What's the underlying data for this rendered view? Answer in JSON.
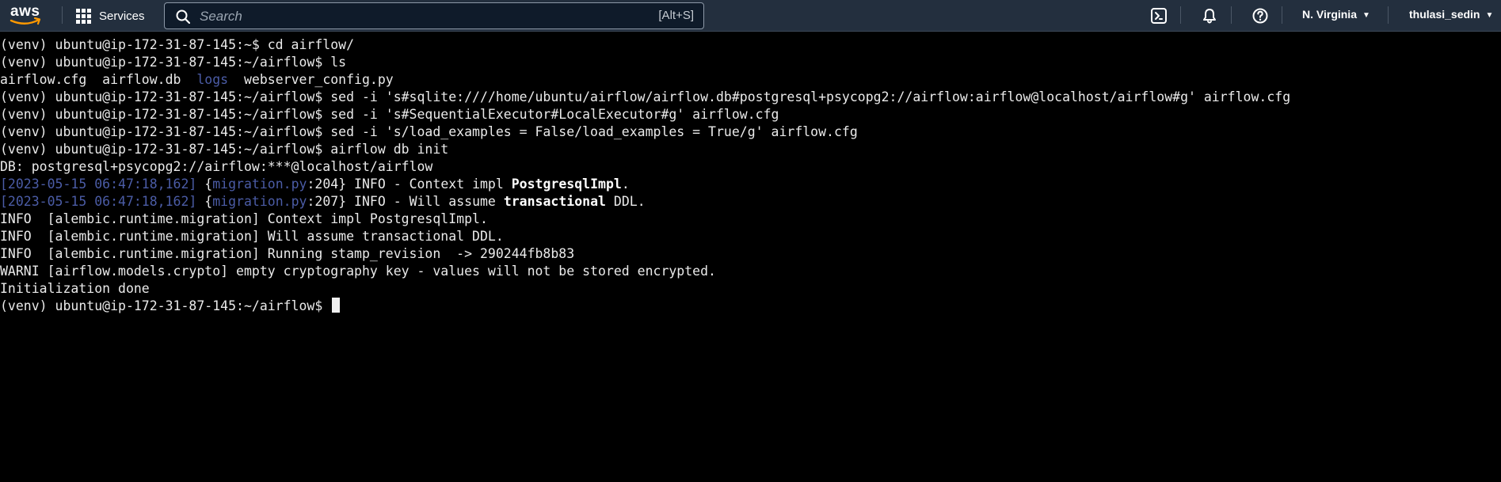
{
  "topbar": {
    "logo_text": "aws",
    "services_label": "Services",
    "search": {
      "placeholder": "Search",
      "shortcut": "[Alt+S]"
    },
    "region_label": "N. Virginia",
    "user_label": "thulasi_sedin"
  },
  "terminal": {
    "lines": [
      {
        "text": "(venv) ubuntu@ip-172-31-87-145:~$ cd airflow/"
      },
      {
        "text": "(venv) ubuntu@ip-172-31-87-145:~/airflow$ ls"
      },
      {
        "text": "airflow.cfg  airflow.db  ",
        "dir": "logs",
        "rest": "  webserver_config.py"
      },
      {
        "text": "(venv) ubuntu@ip-172-31-87-145:~/airflow$ sed -i 's#sqlite:////home/ubuntu/airflow/airflow.db#postgresql+psycopg2://airflow:airflow@localhost/airflow#g' airflow.cfg"
      },
      {
        "text": "(venv) ubuntu@ip-172-31-87-145:~/airflow$ sed -i 's#SequentialExecutor#LocalExecutor#g' airflow.cfg"
      },
      {
        "text": "(venv) ubuntu@ip-172-31-87-145:~/airflow$ sed -i 's/load_examples = False/load_examples = True/g' airflow.cfg"
      },
      {
        "text": "(venv) ubuntu@ip-172-31-87-145:~/airflow$ airflow db init"
      },
      {
        "text": "DB: postgresql+psycopg2://airflow:***@localhost/airflow"
      },
      {
        "ts": "[2023-05-15 06:47:18,162]",
        "mid1": " {",
        "mod": "migration.py",
        "mid2": ":204} INFO - Context impl ",
        "strong": "PostgresqlImpl",
        "tail": "."
      },
      {
        "ts": "[2023-05-15 06:47:18,162]",
        "mid1": " {",
        "mod": "migration.py",
        "mid2": ":207} INFO - Will assume ",
        "strong": "transactional",
        "tail": " DDL."
      },
      {
        "text": "INFO  [alembic.runtime.migration] Context impl PostgresqlImpl."
      },
      {
        "text": "INFO  [alembic.runtime.migration] Will assume transactional DDL."
      },
      {
        "text": "INFO  [alembic.runtime.migration] Running stamp_revision  -> 290244fb8b83"
      },
      {
        "text": "WARNI [airflow.models.crypto] empty cryptography key - values will not be stored encrypted."
      },
      {
        "text": "Initialization done"
      },
      {
        "text": "(venv) ubuntu@ip-172-31-87-145:~/airflow$ "
      }
    ]
  }
}
